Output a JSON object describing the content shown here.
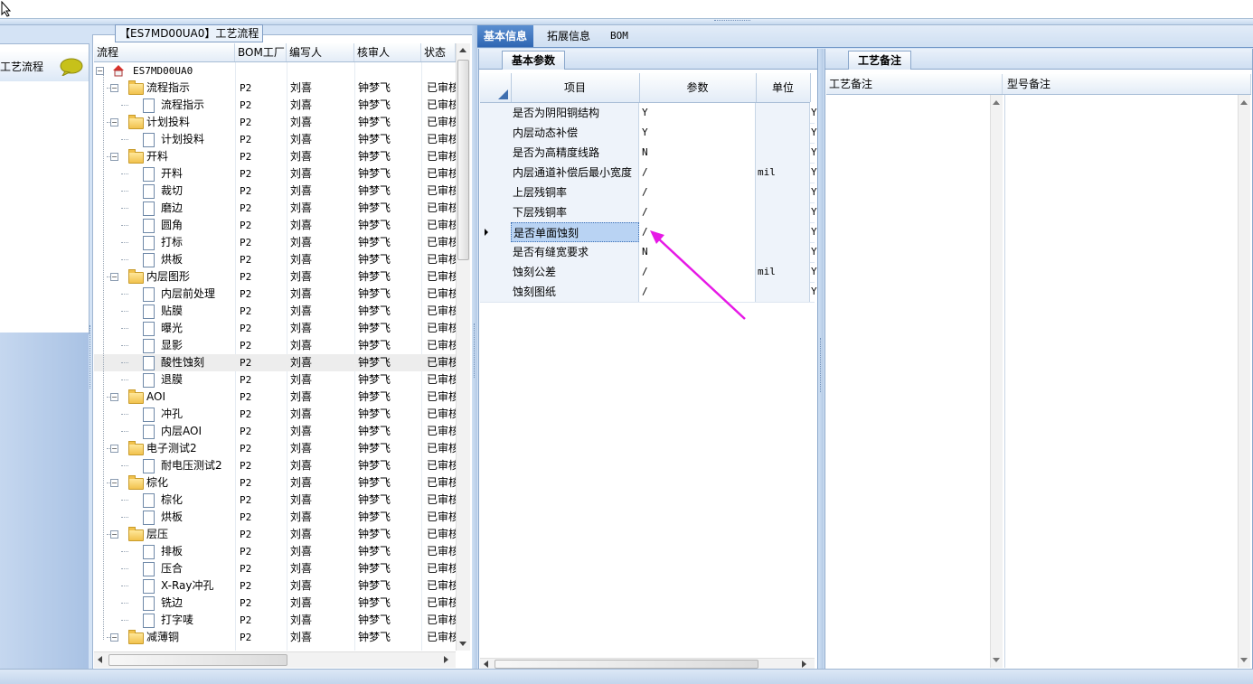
{
  "group_title": "【ES7MD00UA0】工艺流程",
  "left_nav": {
    "item_label": "工艺流程"
  },
  "tree": {
    "headers": [
      "流程",
      "BOM工厂",
      "编写人",
      "核审人",
      "状态"
    ],
    "rows": [
      {
        "name": "ES7MD00UA0",
        "level": 0,
        "kind": "root",
        "factory": "",
        "writer": "",
        "reviewer": "",
        "status": ""
      },
      {
        "name": "流程指示",
        "level": 1,
        "kind": "folder",
        "factory": "P2",
        "writer": "刘喜",
        "reviewer": "钟梦飞",
        "status": "已审核"
      },
      {
        "name": "流程指示",
        "level": 2,
        "kind": "doc",
        "factory": "P2",
        "writer": "刘喜",
        "reviewer": "钟梦飞",
        "status": "已审核"
      },
      {
        "name": "计划投料",
        "level": 1,
        "kind": "folder",
        "factory": "P2",
        "writer": "刘喜",
        "reviewer": "钟梦飞",
        "status": "已审核"
      },
      {
        "name": "计划投料",
        "level": 2,
        "kind": "doc",
        "factory": "P2",
        "writer": "刘喜",
        "reviewer": "钟梦飞",
        "status": "已审核"
      },
      {
        "name": "开料",
        "level": 1,
        "kind": "folder",
        "factory": "P2",
        "writer": "刘喜",
        "reviewer": "钟梦飞",
        "status": "已审核"
      },
      {
        "name": "开料",
        "level": 2,
        "kind": "doc",
        "factory": "P2",
        "writer": "刘喜",
        "reviewer": "钟梦飞",
        "status": "已审核"
      },
      {
        "name": "裁切",
        "level": 2,
        "kind": "doc",
        "factory": "P2",
        "writer": "刘喜",
        "reviewer": "钟梦飞",
        "status": "已审核"
      },
      {
        "name": "磨边",
        "level": 2,
        "kind": "doc",
        "factory": "P2",
        "writer": "刘喜",
        "reviewer": "钟梦飞",
        "status": "已审核"
      },
      {
        "name": "圆角",
        "level": 2,
        "kind": "doc",
        "factory": "P2",
        "writer": "刘喜",
        "reviewer": "钟梦飞",
        "status": "已审核"
      },
      {
        "name": "打标",
        "level": 2,
        "kind": "doc",
        "factory": "P2",
        "writer": "刘喜",
        "reviewer": "钟梦飞",
        "status": "已审核"
      },
      {
        "name": "烘板",
        "level": 2,
        "kind": "doc",
        "factory": "P2",
        "writer": "刘喜",
        "reviewer": "钟梦飞",
        "status": "已审核"
      },
      {
        "name": "内层图形",
        "level": 1,
        "kind": "folder",
        "factory": "P2",
        "writer": "刘喜",
        "reviewer": "钟梦飞",
        "status": "已审核"
      },
      {
        "name": "内层前处理",
        "level": 2,
        "kind": "doc",
        "factory": "P2",
        "writer": "刘喜",
        "reviewer": "钟梦飞",
        "status": "已审核"
      },
      {
        "name": "贴膜",
        "level": 2,
        "kind": "doc",
        "factory": "P2",
        "writer": "刘喜",
        "reviewer": "钟梦飞",
        "status": "已审核"
      },
      {
        "name": "曝光",
        "level": 2,
        "kind": "doc",
        "factory": "P2",
        "writer": "刘喜",
        "reviewer": "钟梦飞",
        "status": "已审核"
      },
      {
        "name": "显影",
        "level": 2,
        "kind": "doc",
        "factory": "P2",
        "writer": "刘喜",
        "reviewer": "钟梦飞",
        "status": "已审核"
      },
      {
        "name": "酸性蚀刻",
        "level": 2,
        "kind": "doc",
        "factory": "P2",
        "writer": "刘喜",
        "reviewer": "钟梦飞",
        "status": "已审核",
        "selected": true
      },
      {
        "name": "退膜",
        "level": 2,
        "kind": "doc",
        "factory": "P2",
        "writer": "刘喜",
        "reviewer": "钟梦飞",
        "status": "已审核"
      },
      {
        "name": "AOI",
        "level": 1,
        "kind": "folder",
        "factory": "P2",
        "writer": "刘喜",
        "reviewer": "钟梦飞",
        "status": "已审核"
      },
      {
        "name": "冲孔",
        "level": 2,
        "kind": "doc",
        "factory": "P2",
        "writer": "刘喜",
        "reviewer": "钟梦飞",
        "status": "已审核"
      },
      {
        "name": "内层AOI",
        "level": 2,
        "kind": "doc",
        "factory": "P2",
        "writer": "刘喜",
        "reviewer": "钟梦飞",
        "status": "已审核"
      },
      {
        "name": "电子测试2",
        "level": 1,
        "kind": "folder",
        "factory": "P2",
        "writer": "刘喜",
        "reviewer": "钟梦飞",
        "status": "已审核"
      },
      {
        "name": "耐电压测试2",
        "level": 2,
        "kind": "doc",
        "factory": "P2",
        "writer": "刘喜",
        "reviewer": "钟梦飞",
        "status": "已审核"
      },
      {
        "name": "棕化",
        "level": 1,
        "kind": "folder",
        "factory": "P2",
        "writer": "刘喜",
        "reviewer": "钟梦飞",
        "status": "已审核"
      },
      {
        "name": "棕化",
        "level": 2,
        "kind": "doc",
        "factory": "P2",
        "writer": "刘喜",
        "reviewer": "钟梦飞",
        "status": "已审核"
      },
      {
        "name": "烘板",
        "level": 2,
        "kind": "doc",
        "factory": "P2",
        "writer": "刘喜",
        "reviewer": "钟梦飞",
        "status": "已审核"
      },
      {
        "name": "层压",
        "level": 1,
        "kind": "folder",
        "factory": "P2",
        "writer": "刘喜",
        "reviewer": "钟梦飞",
        "status": "已审核"
      },
      {
        "name": "排板",
        "level": 2,
        "kind": "doc",
        "factory": "P2",
        "writer": "刘喜",
        "reviewer": "钟梦飞",
        "status": "已审核"
      },
      {
        "name": "压合",
        "level": 2,
        "kind": "doc",
        "factory": "P2",
        "writer": "刘喜",
        "reviewer": "钟梦飞",
        "status": "已审核"
      },
      {
        "name": "X-Ray冲孔",
        "level": 2,
        "kind": "doc",
        "factory": "P2",
        "writer": "刘喜",
        "reviewer": "钟梦飞",
        "status": "已审核"
      },
      {
        "name": "铣边",
        "level": 2,
        "kind": "doc",
        "factory": "P2",
        "writer": "刘喜",
        "reviewer": "钟梦飞",
        "status": "已审核"
      },
      {
        "name": "打字唛",
        "level": 2,
        "kind": "doc",
        "factory": "P2",
        "writer": "刘喜",
        "reviewer": "钟梦飞",
        "status": "已审核"
      },
      {
        "name": "减薄铜",
        "level": 1,
        "kind": "folder",
        "factory": "P2",
        "writer": "刘喜",
        "reviewer": "钟梦飞",
        "status": "已审核"
      }
    ]
  },
  "tabs": [
    "基本信息",
    "拓展信息",
    "BOM"
  ],
  "basic_params": {
    "tab_label": "基本参数",
    "headers": [
      "项目",
      "参数",
      "单位"
    ],
    "rows": [
      {
        "item": "是否为阴阳铜结构",
        "value": "Y",
        "unit": "",
        "flag": "Y"
      },
      {
        "item": "内层动态补偿",
        "value": "Y",
        "unit": "",
        "flag": "Y"
      },
      {
        "item": "是否为高精度线路",
        "value": "N",
        "unit": "",
        "flag": "Y"
      },
      {
        "item": "内层通道补偿后最小宽度",
        "value": "/",
        "unit": "mil",
        "flag": "Y"
      },
      {
        "item": "上层残铜率",
        "value": "/",
        "unit": "",
        "flag": "Y"
      },
      {
        "item": "下层残铜率",
        "value": "/",
        "unit": "",
        "flag": "Y"
      },
      {
        "item": "是否单面蚀刻",
        "value": "/",
        "unit": "",
        "flag": "Y",
        "selected": true
      },
      {
        "item": "是否有缝宽要求",
        "value": "N",
        "unit": "",
        "flag": "Y"
      },
      {
        "item": "蚀刻公差",
        "value": "/",
        "unit": "mil",
        "flag": "Y"
      },
      {
        "item": "蚀刻图纸",
        "value": "/",
        "unit": "",
        "flag": "Y"
      }
    ]
  },
  "process_notes": {
    "tab_label": "工艺备注",
    "headers": [
      "工艺备注",
      "型号备注"
    ]
  },
  "colors": {
    "accent": "#2f66b3",
    "annotation_arrow": "#e619e6",
    "selected_row": "#b9d3f3"
  }
}
